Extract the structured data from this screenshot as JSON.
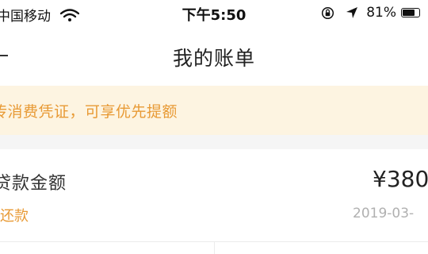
{
  "status_bar": {
    "carrier": "中国移动",
    "time": "下午5:50",
    "battery": "81%",
    "battery_level": 0.81,
    "icons": [
      "wifi-icon",
      "rotation-lock-icon",
      "location-icon",
      "battery-icon"
    ]
  },
  "nav": {
    "title": "我的账单",
    "back_icon": "back-icon"
  },
  "notice": {
    "text": "传消费凭证，可享优先提额"
  },
  "bill": {
    "label": "贷款金额",
    "amount": "¥380",
    "status": "还款",
    "date": "2019-03-"
  },
  "colors": {
    "accent": "#e89a35",
    "notice_bg": "#fdf4e1",
    "gap_bg": "#f5f5f5",
    "muted": "#b0b0b0"
  }
}
